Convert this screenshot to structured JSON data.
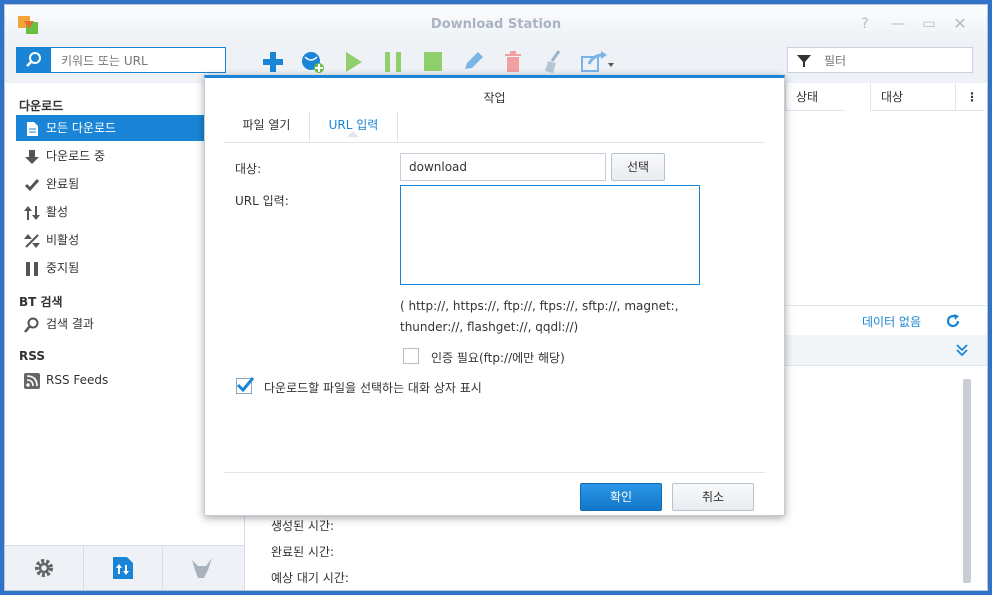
{
  "window": {
    "title": "Download Station"
  },
  "toolbar": {
    "search_placeholder": "키워드 또는 URL",
    "filter_placeholder": "필터"
  },
  "sidebar": {
    "section_downloads": "다운로드",
    "items": [
      {
        "label": "모든 다운로드"
      },
      {
        "label": "다운로드 중"
      },
      {
        "label": "완료됨"
      },
      {
        "label": "활성"
      },
      {
        "label": "비활성"
      },
      {
        "label": "중지됨"
      }
    ],
    "section_bt": "BT 검색",
    "search_results": "검색 결과",
    "section_rss": "RSS",
    "rss_feeds": "RSS Feeds"
  },
  "table": {
    "columns": [
      "상태",
      "대상"
    ],
    "no_data": "데이터 없음"
  },
  "details": {
    "created_time": "생성된 시간:",
    "completed_time": "완료된 시간:",
    "estimated_wait": "예상 대기 시간:"
  },
  "dialog": {
    "title": "작업",
    "tabs": [
      "파일 열기",
      "URL 입력"
    ],
    "target_label": "대상:",
    "target_value": "download",
    "select_button": "선택",
    "url_label": "URL 입력:",
    "url_value": "",
    "protocols_hint": "( http://, https://, ftp://, ftps://, sftp://, magnet:, thunder://, flashget://, qqdl://)",
    "auth_label": "인증 필요(ftp://에만 해당)",
    "auth_checked": false,
    "show_dialog_label": "다운로드할 파일을 선택하는 대화 상자 표시",
    "show_dialog_checked": true,
    "ok_button": "확인",
    "cancel_button": "취소"
  },
  "colors": {
    "accent": "#1a85d6",
    "play": "#6abf40",
    "delete": "#e36f6f"
  }
}
